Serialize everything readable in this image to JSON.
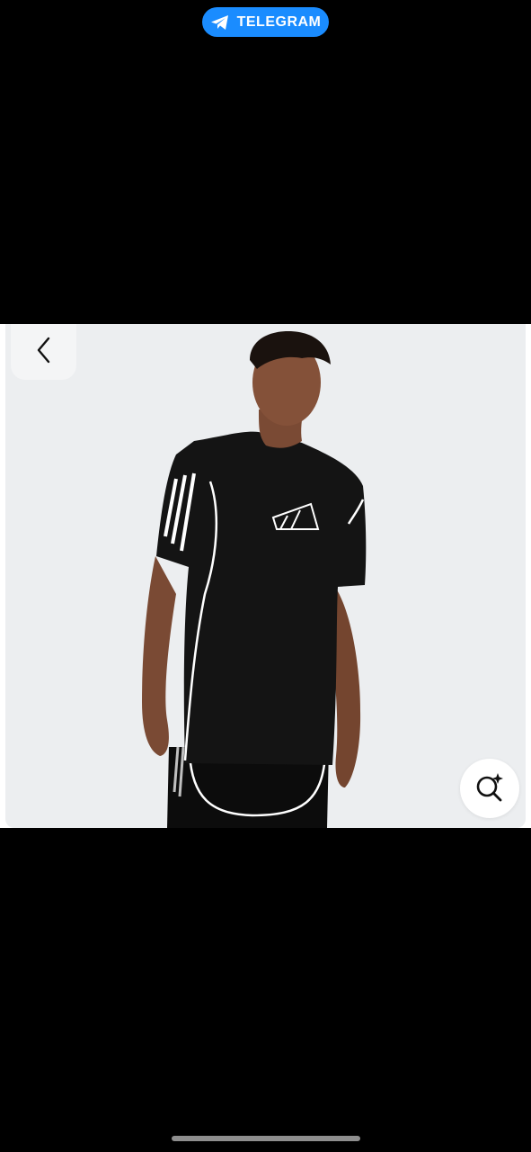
{
  "telegram_pill": {
    "label": "TELEGRAM",
    "color": "#1a8cff",
    "icon": "telegram-plane-icon"
  },
  "product_image": {
    "description_hidden": true,
    "background_color": "#eceef0"
  },
  "controls": {
    "back_icon": "chevron-left-icon",
    "lens_icon": "visual-search-sparkle-icon"
  },
  "home_indicator": {
    "color": "#8e8e8e"
  }
}
